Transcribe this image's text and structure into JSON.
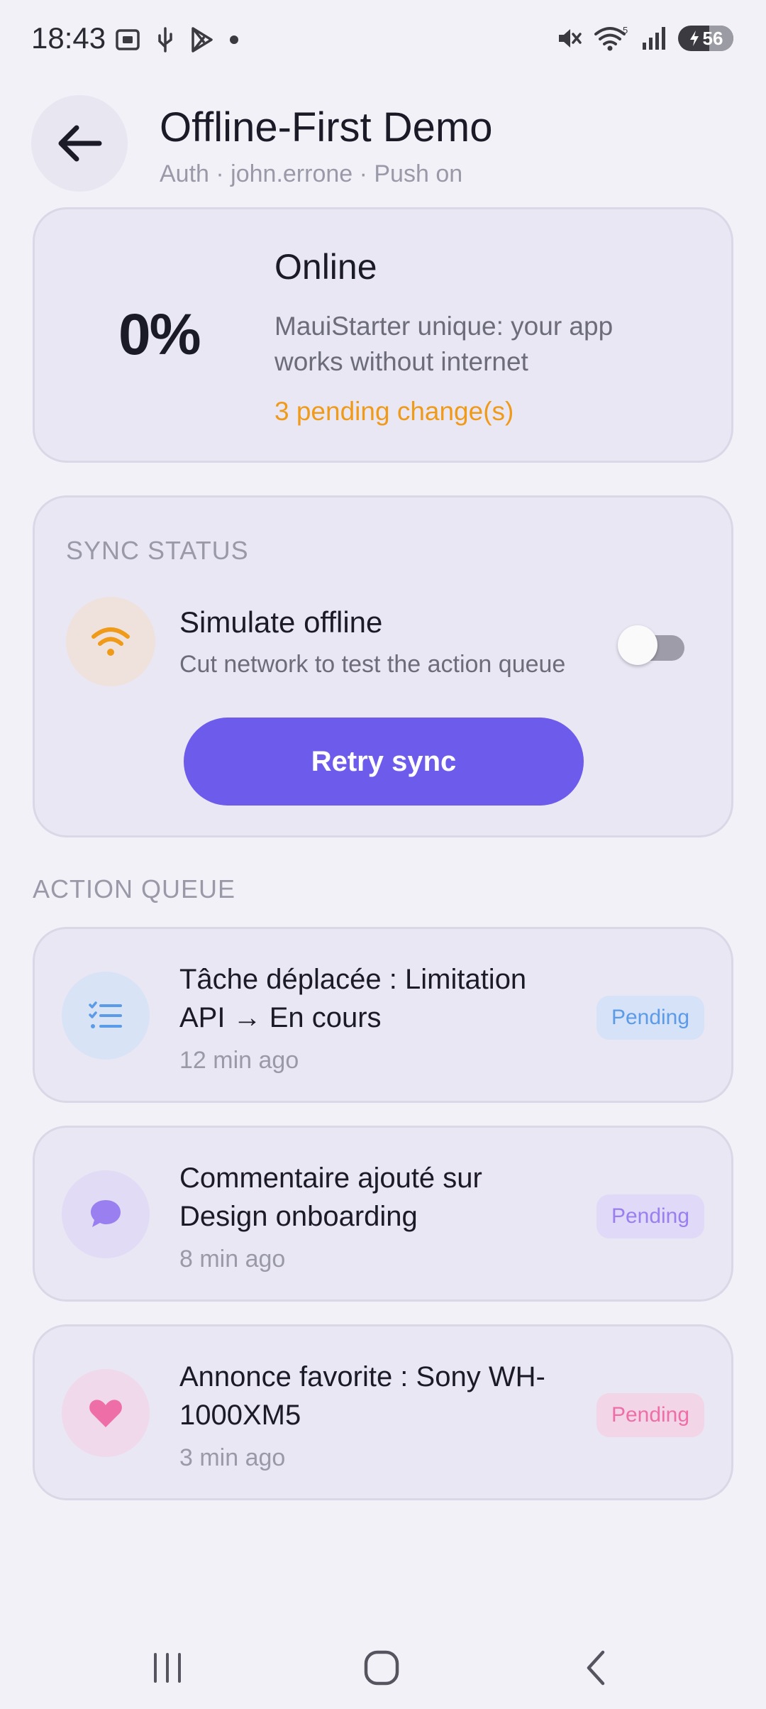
{
  "status_bar": {
    "time": "18:43",
    "battery_level": "56"
  },
  "header": {
    "title": "Offline-First Demo",
    "subtitle": "Auth · john.errone · Push on"
  },
  "status_card": {
    "percent": "0%",
    "state": "Online",
    "description": "MauiStarter unique: your app works without internet",
    "pending_text": "3 pending change(s)"
  },
  "sync_card": {
    "section_label": "SYNC STATUS",
    "simulate_title": "Simulate offline",
    "simulate_desc": "Cut network to test the action queue",
    "simulate_enabled": false,
    "retry_label": "Retry sync"
  },
  "queue": {
    "section_label": "ACTION QUEUE",
    "items": [
      {
        "icon": "task-list-icon",
        "title": "Tâche déplacée : Limitation API → En cours",
        "time": "12 min ago",
        "badge": "Pending",
        "color": "#5b9be8"
      },
      {
        "icon": "comment-icon",
        "title": "Commentaire ajouté sur Design onboarding",
        "time": "8 min ago",
        "badge": "Pending",
        "color": "#9a7ff0"
      },
      {
        "icon": "heart-icon",
        "title": "Annonce favorite : Sony WH-1000XM5",
        "time": "3 min ago",
        "badge": "Pending",
        "color": "#ee6fa8"
      }
    ]
  },
  "colors": {
    "accent": "#6d5bec",
    "pending": "#f09a1a",
    "background": "#f2f1f8",
    "card": "#e9e7f4"
  }
}
